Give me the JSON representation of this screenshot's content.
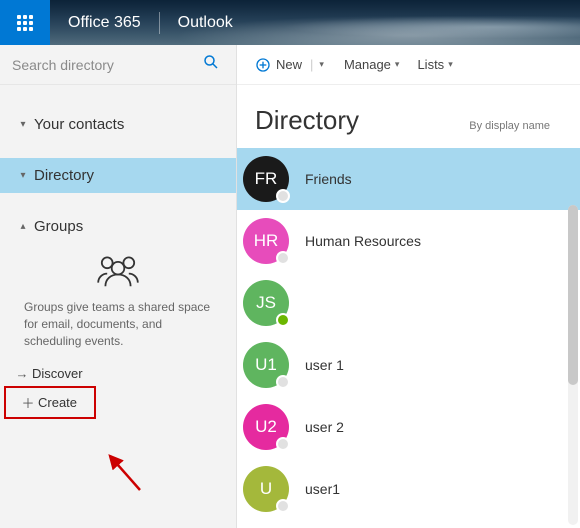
{
  "header": {
    "brand": "Office 365",
    "app": "Outlook"
  },
  "search": {
    "placeholder": "Search directory"
  },
  "sidebar": {
    "items": [
      {
        "label": "Your contacts",
        "expanded": false
      },
      {
        "label": "Directory",
        "expanded": false,
        "selected": true
      },
      {
        "label": "Groups",
        "expanded": true
      }
    ],
    "groups_desc": "Groups give teams a shared space for email, documents, and scheduling events.",
    "links": [
      {
        "label": "Discover",
        "icon": "arrow"
      },
      {
        "label": "Create",
        "icon": "plus"
      }
    ]
  },
  "commands": {
    "new": "New",
    "manage": "Manage",
    "lists": "Lists"
  },
  "main": {
    "title": "Directory",
    "sort": "By display name"
  },
  "contacts": [
    {
      "initials": "FR",
      "name": "Friends",
      "color": "#1a1a1a",
      "presence": "none",
      "selected": true
    },
    {
      "initials": "HR",
      "name": "Human Resources",
      "color": "#e74cbb",
      "presence": "none"
    },
    {
      "initials": "JS",
      "name": " ",
      "color": "#5fb55f",
      "presence": "green"
    },
    {
      "initials": "U1",
      "name": "user 1",
      "color": "#5fb55f",
      "presence": "none"
    },
    {
      "initials": "U2",
      "name": "user 2",
      "color": "#e52a9f",
      "presence": "none"
    },
    {
      "initials": "U",
      "name": "user1",
      "color": "#a4b83b",
      "presence": "none"
    }
  ]
}
